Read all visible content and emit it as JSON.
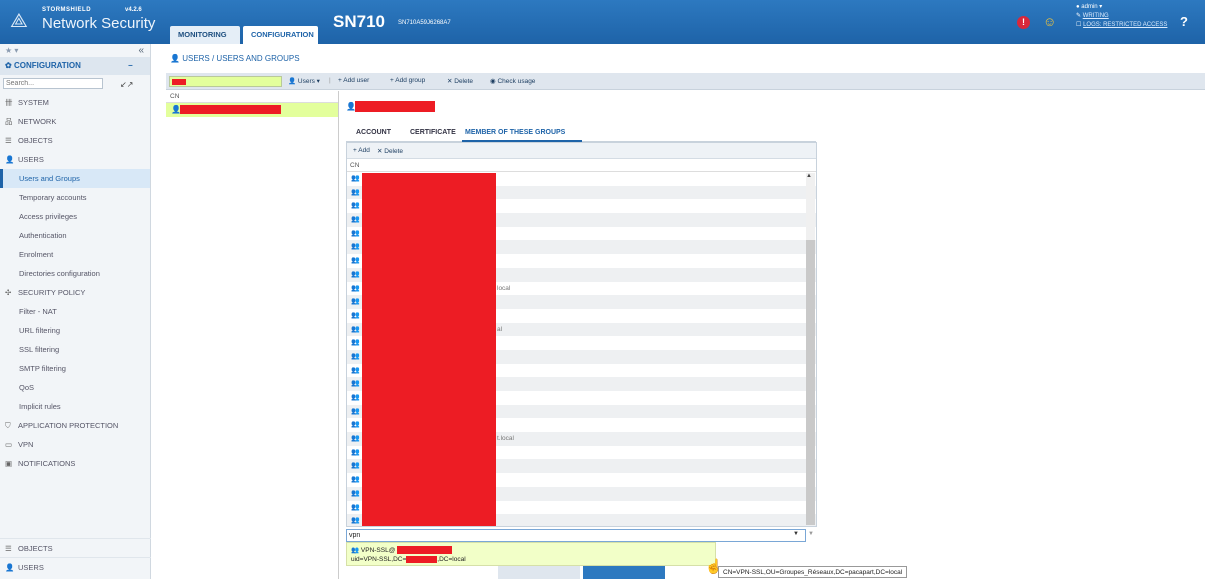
{
  "header": {
    "brand": "STORMSHIELD",
    "version": "v4.2.6",
    "product": "Network Security",
    "nav_monitoring": "MONITORING",
    "nav_configuration": "CONFIGURATION",
    "model": "SN710",
    "serial": "SN710A59J6268A7",
    "admin": "admin",
    "writing": "WRITING",
    "logs_access": "LOGS: RESTRICTED ACCESS",
    "help": "?"
  },
  "sidebar": {
    "favorites": "★ ▾",
    "collapse": "«",
    "section_title": "CONFIGURATION",
    "section_toggle": "−",
    "search_placeholder": "Search...",
    "expand": "↙↗",
    "items": [
      {
        "label": "SYSTEM",
        "icon": "system-icon",
        "glyph": "卌"
      },
      {
        "label": "NETWORK",
        "icon": "network-icon",
        "glyph": "品"
      },
      {
        "label": "OBJECTS",
        "icon": "objects-icon",
        "glyph": "☰"
      },
      {
        "label": "USERS",
        "icon": "users-icon",
        "glyph": "👤"
      }
    ],
    "users_sub": [
      "Users and Groups",
      "Temporary accounts",
      "Access privileges",
      "Authentication",
      "Enrolment",
      "Directories configuration"
    ],
    "security_policy": "SECURITY POLICY",
    "security_sub": [
      "Filter - NAT",
      "URL filtering",
      "SSL filtering",
      "SMTP filtering",
      "QoS",
      "Implicit rules"
    ],
    "application_protection": "APPLICATION PROTECTION",
    "vpn": "VPN",
    "notifications": "NOTIFICATIONS",
    "bottom": [
      "OBJECTS",
      "USERS"
    ]
  },
  "main": {
    "breadcrumb": "USERS / USERS AND GROUPS",
    "toolbar": {
      "users": "Users ▾",
      "sep": "|",
      "add_user": "+ Add user",
      "add_group": "+ Add group",
      "delete": "✕ Delete",
      "check_usage": "◉ Check usage"
    },
    "list_header": "CN",
    "tabs": [
      "ACCOUNT",
      "CERTIFICATE",
      "MEMBER OF THESE GROUPS"
    ],
    "groups_toolbar": {
      "add": "+ Add",
      "delete": "✕ Delete"
    },
    "groups_header": "CN",
    "group_row_tails": [
      "",
      "",
      "",
      "",
      "",
      "",
      "",
      "",
      "local",
      "",
      "",
      "al",
      "",
      "",
      "",
      "",
      "",
      "",
      "",
      "t.local",
      "",
      "",
      "",
      "",
      "",
      "",
      "",
      ""
    ],
    "combo_value": "vpn",
    "suggestion_line1": "VPN-SSL@",
    "suggestion_line2_prefix": "uid=VPN-SSL,DC=",
    "suggestion_line2_suffix": ",DC=local",
    "tooltip": "CN=VPN-SSL,OU=Groupes_Réseaux,DC=pacapart,DC=local"
  }
}
